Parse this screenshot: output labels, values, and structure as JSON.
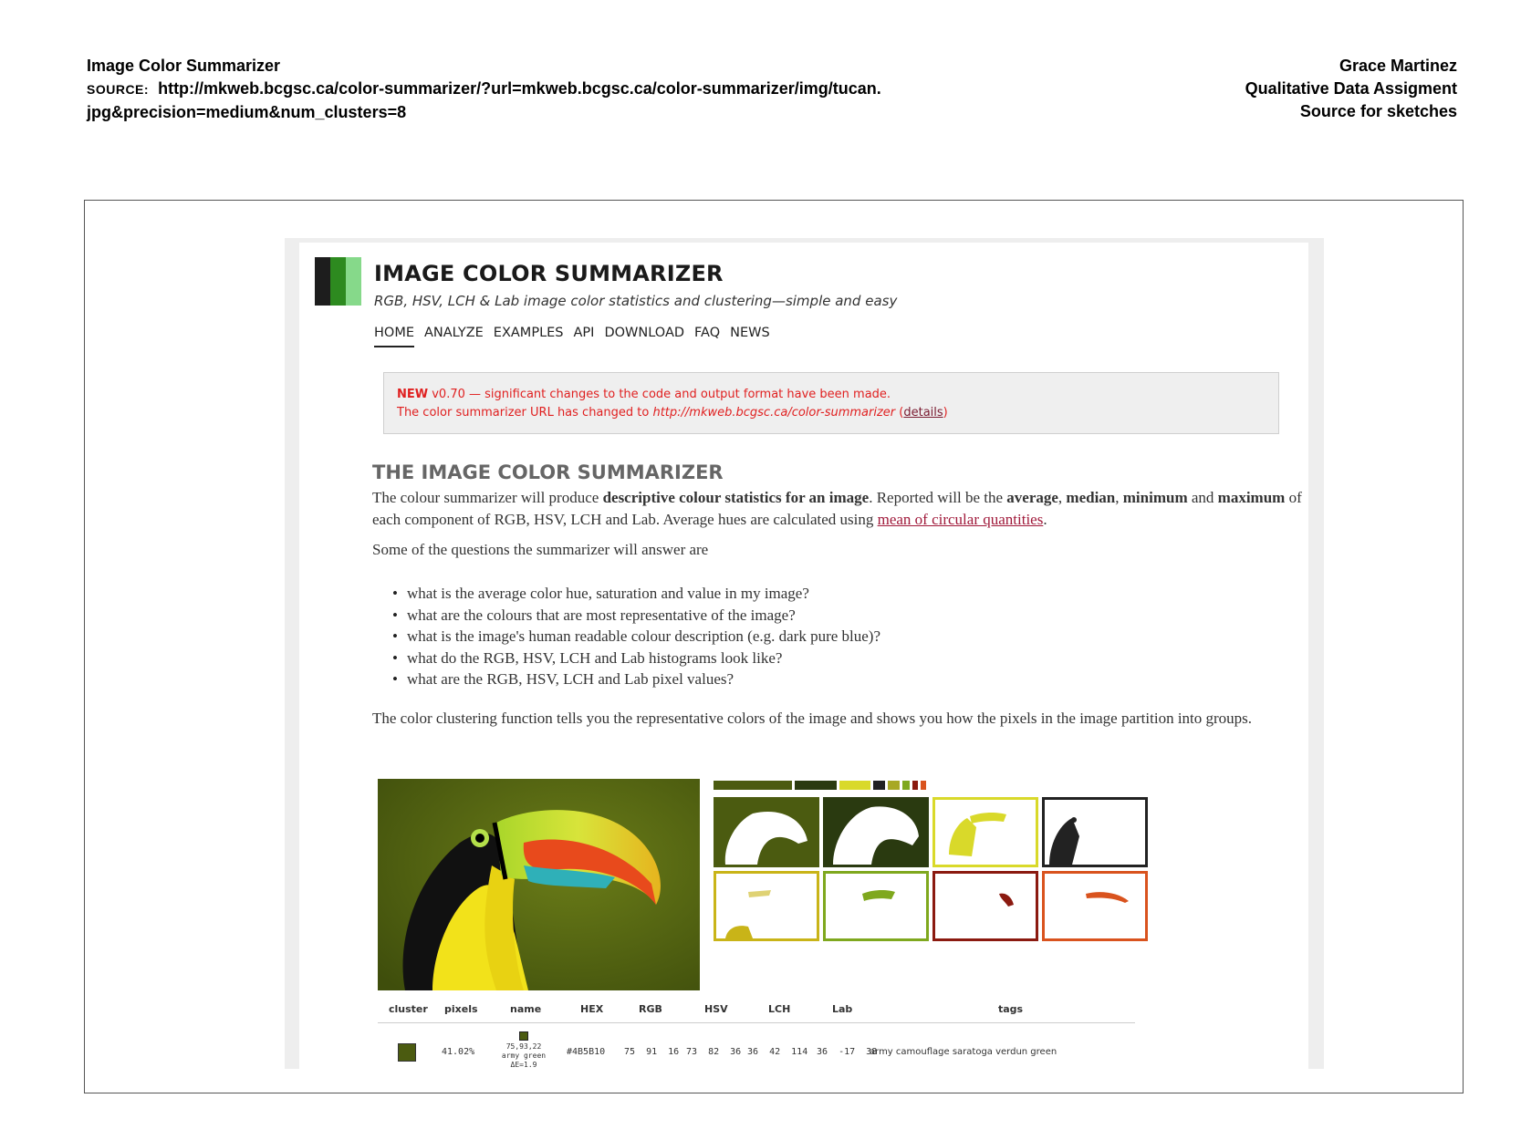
{
  "sheet": {
    "title": "Image Color Summarizer",
    "source_label": "SOURCE:",
    "source_url_line1": "http://mkweb.bcgsc.ca/color-summarizer/?url=mkweb.bcgsc.ca/color-summarizer/img/tucan.",
    "source_url_line2": "jpg&precision=medium&num_clusters=8",
    "author": "Grace Martinez",
    "assignment": "Qualitative Data Assigment",
    "purpose": "Source for sketches"
  },
  "site": {
    "title": "IMAGE COLOR SUMMARIZER",
    "subtitle": "RGB, HSV, LCH & Lab image color statistics and clustering—simple and easy",
    "logo_colors": [
      "#1d1d1d",
      "#2d8a1f",
      "#86d98a"
    ]
  },
  "nav": {
    "items": [
      {
        "label": "HOME",
        "active": true
      },
      {
        "label": "ANALYZE"
      },
      {
        "label": "EXAMPLES"
      },
      {
        "label": "API"
      },
      {
        "label": "DOWNLOAD"
      },
      {
        "label": "FAQ"
      },
      {
        "label": "NEWS"
      }
    ]
  },
  "notice": {
    "new_label": "NEW",
    "line1_rest": " v0.70 — significant changes to the code and output format have been made.",
    "line2_prefix": "The color summarizer URL has changed to ",
    "line2_url": "http://mkweb.bcgsc.ca/color-summarizer",
    "details_open": " (",
    "details_link": "details",
    "details_close": ")"
  },
  "content": {
    "heading": "THE IMAGE COLOR SUMMARIZER",
    "p1_a": "The colour summarizer will produce ",
    "p1_b": "descriptive colour statistics for an image",
    "p1_c": ". Reported will be the ",
    "p1_d": "average",
    "p1_e": ", ",
    "p1_f": "median",
    "p1_g": ", ",
    "p1_h": "minimum",
    "p1_i": " and ",
    "p1_j": "maximum",
    "p1_k": " of each component of RGB, HSV, LCH and Lab. Average hues are calculated using ",
    "p1_link": "mean of circular quantities",
    "p1_end": ".",
    "p2": "Some of the questions the summarizer will answer are",
    "questions": [
      "what is the average color hue, saturation and value in my image?",
      "what are the colours that are most representative of the image?",
      "what is the image's human readable colour description (e.g. dark pure blue)?",
      "what do the RGB, HSV, LCH and Lab histograms look like?",
      "what are the RGB, HSV, LCH and Lab pixel values?"
    ],
    "p3": "The color clustering function tells you the representative colors of the image and shows you how the pixels in the image partition into groups."
  },
  "palette": [
    {
      "color": "#4b5b10",
      "share": 41
    },
    {
      "color": "#2a3a10",
      "share": 22
    },
    {
      "color": "#d9d92a",
      "share": 16
    },
    {
      "color": "#222222",
      "share": 6
    },
    {
      "color": "#a8a824",
      "share": 6
    },
    {
      "color": "#7fa81e",
      "share": 4
    },
    {
      "color": "#8b1a10",
      "share": 2.5
    },
    {
      "color": "#d9531e",
      "share": 2.5
    }
  ],
  "clusters": [
    {
      "border": "#4b5b10"
    },
    {
      "border": "#2a3a10"
    },
    {
      "border": "#d9d92a"
    },
    {
      "border": "#222222"
    },
    {
      "border": "#c9b418"
    },
    {
      "border": "#7fa81e"
    },
    {
      "border": "#8b1a10"
    },
    {
      "border": "#d9531e"
    }
  ],
  "table": {
    "headers": [
      "cluster",
      "pixels",
      "name",
      "HEX",
      "RGB",
      "HSV",
      "LCH",
      "Lab",
      "tags"
    ],
    "row": {
      "color": "#4b5b10",
      "pixels": "41.02%",
      "name_rgb": "75,93,22",
      "name": "army green",
      "delta": "ΔE=1.9",
      "hex": "#4B5B10",
      "rgb": "75  91  16",
      "hsv": "73  82  36",
      "lch": "36  42  114",
      "lab": "36  -17  38",
      "tags": "army camouflage saratoga verdun green"
    }
  }
}
